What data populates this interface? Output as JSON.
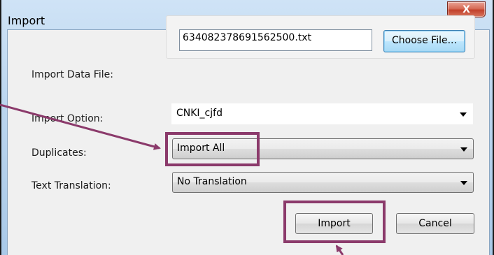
{
  "window": {
    "title": "Import",
    "close_label": "X"
  },
  "form": {
    "import_data_file": {
      "label": "Import Data File:",
      "value": "634082378691562500.txt",
      "button_label": "Choose File..."
    },
    "import_option": {
      "label": "Import Option:",
      "selected": "CNKI_cjfd"
    },
    "duplicates": {
      "label": "Duplicates:",
      "selected": "Import All"
    },
    "text_translation": {
      "label": "Text Translation:",
      "selected": "No Translation"
    }
  },
  "actions": {
    "import_label": "Import",
    "cancel_label": "Cancel"
  },
  "annotations": {
    "highlight_color": "#8b3a6b"
  },
  "icons": [
    "close-icon",
    "chevron-down-icon"
  ]
}
